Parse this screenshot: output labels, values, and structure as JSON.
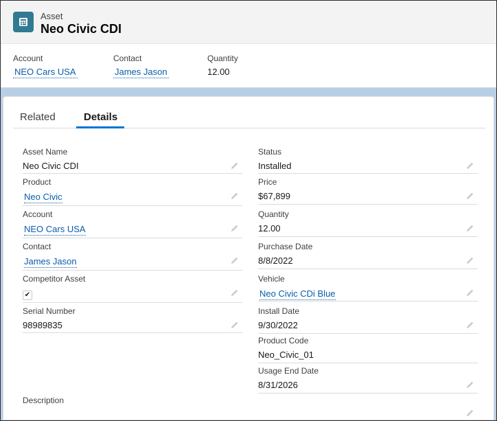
{
  "record": {
    "object_label": "Asset",
    "title": "Neo Civic CDI",
    "icon": "asset-icon",
    "icon_color": "#317a92"
  },
  "highlights": [
    {
      "label": "Account",
      "value": "NEO Cars USA",
      "link": true
    },
    {
      "label": "Contact",
      "value": "James Jason",
      "link": true
    },
    {
      "label": "Quantity",
      "value": "12.00",
      "link": false
    }
  ],
  "tabs": [
    {
      "label": "Related",
      "active": false
    },
    {
      "label": "Details",
      "active": true
    }
  ],
  "details": {
    "left": [
      {
        "label": "Asset Name",
        "value": "Neo Civic CDI",
        "type": "text"
      },
      {
        "label": "Product",
        "value": "Neo Civic",
        "type": "link"
      },
      {
        "label": "Account",
        "value": "NEO Cars USA",
        "type": "link"
      },
      {
        "label": "Contact",
        "value": "James Jason",
        "type": "link"
      },
      {
        "label": "Competitor Asset",
        "value": "true",
        "type": "checkbox"
      },
      {
        "label": "Serial Number",
        "value": "98989835",
        "type": "text"
      }
    ],
    "right": [
      {
        "label": "Status",
        "value": "Installed",
        "type": "text"
      },
      {
        "label": "Price",
        "value": "$67,899",
        "type": "text"
      },
      {
        "label": "Quantity",
        "value": "12.00",
        "type": "text"
      },
      {
        "label": "Purchase Date",
        "value": "8/8/2022",
        "type": "text"
      },
      {
        "label": "Vehicle",
        "value": "Neo Civic CDi Blue",
        "type": "link"
      },
      {
        "label": "Install Date",
        "value": "9/30/2022",
        "type": "text"
      },
      {
        "label": "Product Code",
        "value": "Neo_Civic_01",
        "type": "text"
      },
      {
        "label": "Usage End Date",
        "value": "8/31/2026",
        "type": "text"
      }
    ],
    "description": {
      "label": "Description",
      "value": ""
    }
  },
  "colors": {
    "link": "#0b5cab",
    "tab_active_underline": "#0176d3",
    "page_background": "#b9cfe6"
  }
}
